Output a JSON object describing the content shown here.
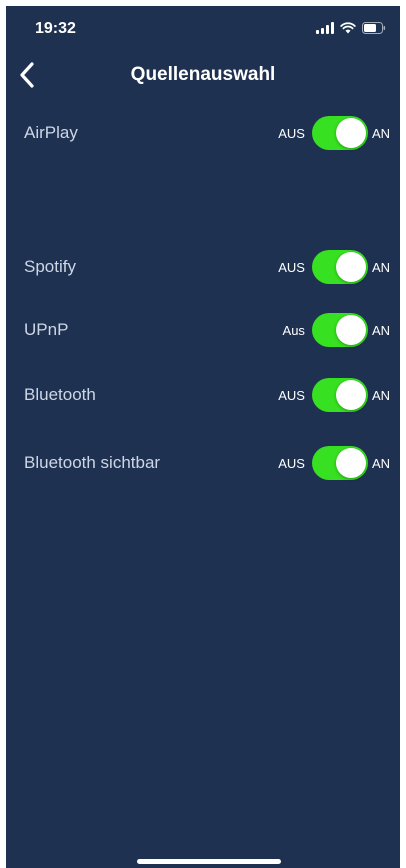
{
  "status_bar": {
    "time": "19:32",
    "icons": [
      "signal-icon",
      "wifi-icon",
      "battery-icon"
    ]
  },
  "nav": {
    "title": "Quellenauswahl",
    "back_icon": "chevron-left-icon"
  },
  "rows": [
    {
      "label": "AirPlay",
      "off_label": "AUS",
      "on_label": "AN",
      "enabled": true
    },
    {
      "label": "Spotify",
      "off_label": "AUS",
      "on_label": "AN",
      "enabled": true
    },
    {
      "label": "UPnP",
      "off_label": "Aus",
      "on_label": "AN",
      "enabled": true
    },
    {
      "label": "Bluetooth",
      "off_label": "AUS",
      "on_label": "AN",
      "enabled": true
    },
    {
      "label": "Bluetooth sichtbar",
      "off_label": "AUS",
      "on_label": "AN",
      "enabled": true
    }
  ],
  "colors": {
    "background": "#1f3150",
    "toggle_on": "#37e020",
    "label": "#cdd6e6"
  }
}
